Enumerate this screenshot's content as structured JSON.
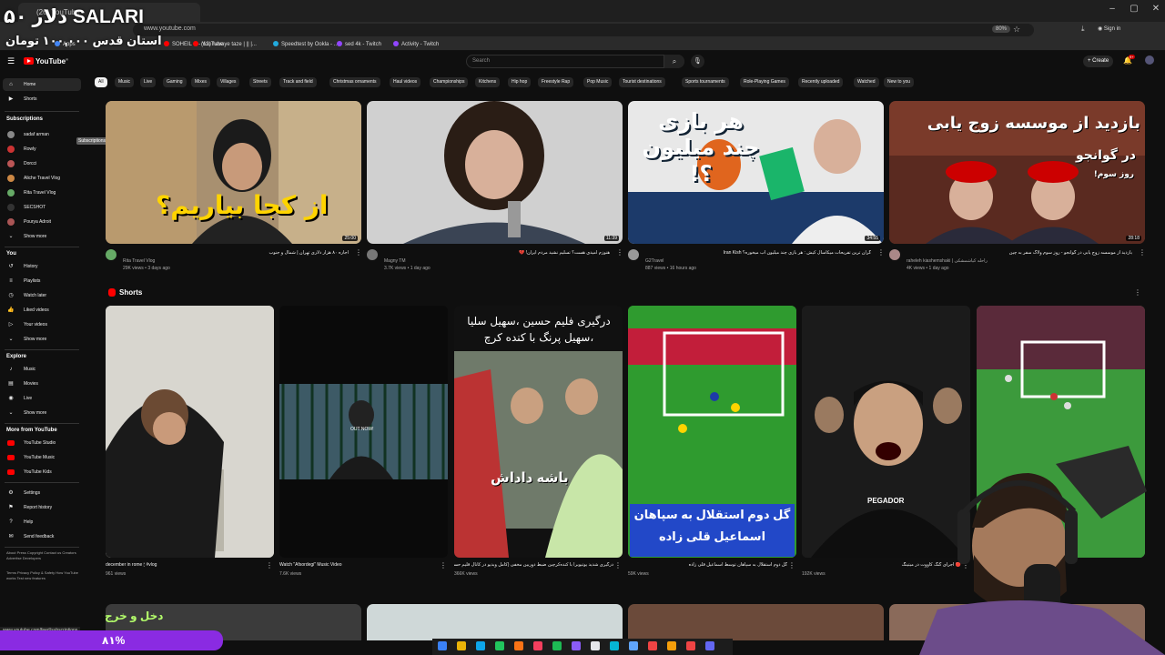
{
  "browser": {
    "tab_title": "(26) YouTube",
    "url": "www.youtube.com",
    "zoom": "80%",
    "sign_in": "Sign in",
    "bookmarks": [
      {
        "label": "Apps",
        "color": "#4285f4"
      },
      {
        "label": "SOHEIL S - YouTube",
        "color": "#ff0000"
      },
      {
        "label": "(12) havaye taze | || |...",
        "color": "#ff0000"
      },
      {
        "label": "Speedtest by Ookla - ...",
        "color": "#2ad"
      },
      {
        "label": "sed 4k - Twitch",
        "color": "#9146ff"
      },
      {
        "label": "Activity - Twitch",
        "color": "#9146ff"
      }
    ]
  },
  "overlay": {
    "title": "۵۰ دلار SALARI",
    "subtitle": "استان قدس ۱۰۰,۰۰۰ تومان",
    "exit_text": "دخل و خرج",
    "percent": "۸۱%",
    "percent_fraction": 0.81,
    "status_url": "www.youtube.com/feed/subscriptions"
  },
  "header": {
    "logo": "YouTube",
    "logo_country": "IR",
    "search_placeholder": "Search",
    "create_label": "Create",
    "notifications": "9+"
  },
  "sidebar": {
    "main": [
      {
        "label": "Home",
        "icon": "home-icon",
        "active": true
      },
      {
        "label": "Shorts",
        "icon": "shorts-icon",
        "active": false
      }
    ],
    "subscriptions_heading": "Subscriptions",
    "subscriptions": [
      {
        "label": "sadaf arman",
        "color": "#888"
      },
      {
        "label": "Rowly",
        "color": "#c33"
      },
      {
        "label": "Dorcci",
        "color": "#b55"
      },
      {
        "label": "Aliche Travel Vlog",
        "color": "#c84"
      },
      {
        "label": "Rita Travel Vlog",
        "color": "#6a6"
      },
      {
        "label": "SECSHOT",
        "color": "#333"
      },
      {
        "label": "Pourya Adroit",
        "color": "#a55"
      },
      {
        "label": "Show more",
        "color": ""
      }
    ],
    "tooltip": "Subscriptions",
    "you_heading": "You",
    "you": [
      {
        "label": "History",
        "icon": "history-icon"
      },
      {
        "label": "Playlists",
        "icon": "playlists-icon"
      },
      {
        "label": "Watch later",
        "icon": "watch-later-icon"
      },
      {
        "label": "Liked videos",
        "icon": "like-icon"
      },
      {
        "label": "Your videos",
        "icon": "your-videos-icon"
      },
      {
        "label": "Show more",
        "icon": "chevron-down-icon"
      }
    ],
    "explore_heading": "Explore",
    "explore": [
      {
        "label": "Music",
        "icon": "music-icon"
      },
      {
        "label": "Movies",
        "icon": "movies-icon"
      },
      {
        "label": "Live",
        "icon": "live-icon"
      },
      {
        "label": "Show more",
        "icon": "chevron-down-icon"
      }
    ],
    "more_heading": "More from YouTube",
    "more": [
      {
        "label": "YouTube Studio",
        "icon": "studio-icon"
      },
      {
        "label": "YouTube Music",
        "icon": "yt-music-icon"
      },
      {
        "label": "YouTube Kids",
        "icon": "yt-kids-icon"
      }
    ],
    "settings": [
      {
        "label": "Settings",
        "icon": "gear-icon"
      },
      {
        "label": "Report history",
        "icon": "flag-icon"
      },
      {
        "label": "Help",
        "icon": "help-icon"
      },
      {
        "label": "Send feedback",
        "icon": "feedback-icon"
      }
    ],
    "footer1": "About  Press  Copyright  Contact us  Creators  Advertise  Developers",
    "footer2": "Terms  Privacy  Policy & Safety  How YouTube works  Test new features"
  },
  "chips": [
    "All",
    "Music",
    "Live",
    "Gaming",
    "Mixes",
    "Villages",
    "Streets",
    "Track and field",
    "Christmas ornaments",
    "Haul videos",
    "Championships",
    "Kitchens",
    "Hip hop",
    "Freestyle Rap",
    "Pop Music",
    "Tourist destinations",
    "Sports tournaments",
    "Role-Playing Games",
    "Recently uploaded",
    "Watched",
    "New to you"
  ],
  "videos": [
    {
      "title": "اجاره ۸۰ هزار دلاری تهران | شمال و جنوب",
      "channel": "Rita Travel Vlog",
      "meta": "29K views • 3 days ago",
      "duration": "25:00",
      "thumb_text": "از کجا بیاریم؟",
      "bg": "#a89070",
      "avatar": "#6a6"
    },
    {
      "title": "هنوزم امیدی هست؟ تسلیم نشید مردم ایران! 💔",
      "channel": "Magny TM",
      "meta": "3.7K views • 1 day ago",
      "duration": "11:39",
      "thumb_text": "",
      "bg": "#d0d0d0",
      "avatar": "#777"
    },
    {
      "title": "گران ترین تفریحات میکاسال کیش : هر بازی چند میلیون آب میخوره؟ Iran Kish",
      "channel": "G2Travel",
      "meta": "887 views • 16 hours ago",
      "duration": "34:55",
      "thumb_text": "هر بازی چند میلیون ؟!",
      "bg": "#e8e8e8",
      "avatar": "#999"
    },
    {
      "title": "بازدید از موسسه زوج یابی در گوانجو - روز سوم ولاگ سفر به چین",
      "channel": "raheleh kiashemshaki | راحله کیاشمشکی",
      "meta": "4K views • 1 day ago",
      "duration": "28:18",
      "thumb_text": "بازدید از موسسه زوج یابی",
      "thumb_sub": "در گوانجو",
      "thumb_sub2": "روز سوم!",
      "bg": "#7a3a2a",
      "avatar": "#a88"
    }
  ],
  "shorts_heading": "Shorts",
  "shorts": [
    {
      "title": "december in rome 🕯 #vlog",
      "views": "961 views",
      "bg": "#cfcfc8",
      "caption": ""
    },
    {
      "title": "Watch \"Afsordegi\" Music Video",
      "views": "7.6K views",
      "bg": "#0a0a0a",
      "caption": "OUT NOW!"
    },
    {
      "title": "درگیری شدید یوتیوبرا با کندەکرچین ضبط دوربین مخفی (کامل ویدیو در کانال قلیم حسین)",
      "views": "366K views",
      "bg": "#111",
      "caption": "درگیری فلیم حسین ،سهیل سلیا ،سهیل پرنگ با کنده کرچ",
      "caption2": "باشه داداش"
    },
    {
      "title": "گل دوم استقلال به سپاهان توسط اسماعیل قلی زاده",
      "views": "59K views",
      "bg": "#3aa83a",
      "caption": "گل دوم استقلال به سپاهان",
      "caption2": "اسماعیل قلی زاده"
    },
    {
      "title": "🔴 اجرای گنگ کاووت در میتینگ",
      "views": "192K views",
      "bg": "#222",
      "caption": "PEGADOR"
    },
    {
      "title": "",
      "views": "",
      "bg": "#4a9a4a",
      "caption": ""
    }
  ],
  "colors": {
    "accent": "#ff0000",
    "overlay_purple": "#8a2be2",
    "overlay_green": "#b4ff6b"
  }
}
